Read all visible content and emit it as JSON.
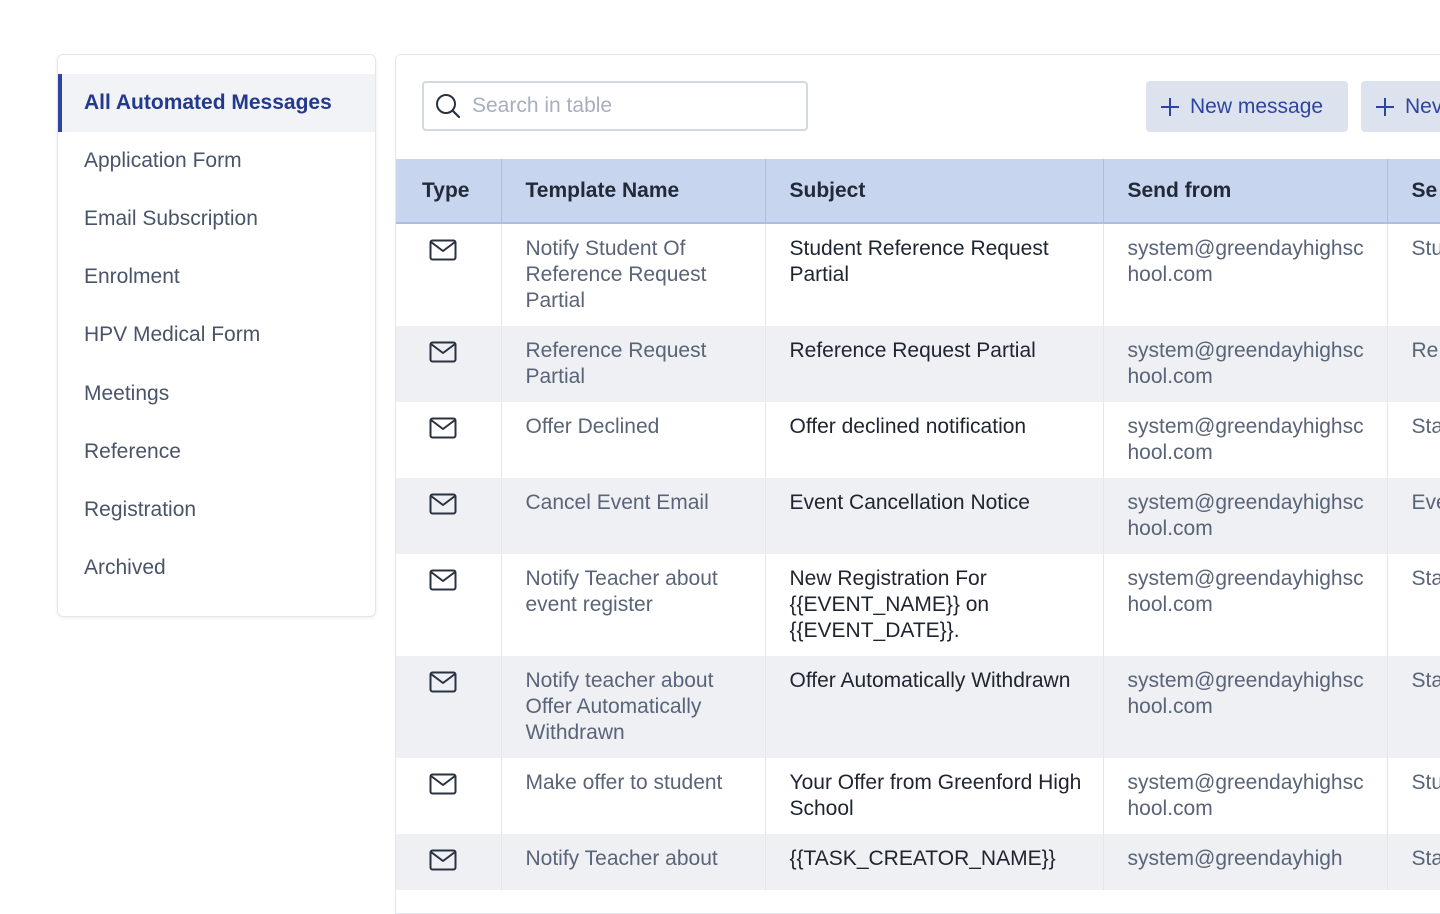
{
  "sidebar": {
    "items": [
      {
        "label": "All Automated Messages",
        "active": true
      },
      {
        "label": "Application Form"
      },
      {
        "label": "Email Subscription"
      },
      {
        "label": "Enrolment"
      },
      {
        "label": "HPV Medical Form"
      },
      {
        "label": "Meetings"
      },
      {
        "label": "Reference"
      },
      {
        "label": "Registration"
      },
      {
        "label": "Archived"
      }
    ]
  },
  "toolbar": {
    "search_placeholder": "Search in table",
    "search_icon": "search-icon",
    "new_message_label": "New message",
    "second_button_label": "Nev"
  },
  "table": {
    "columns": [
      "Type",
      "Template Name",
      "Subject",
      "Send from",
      "Se"
    ],
    "rows": [
      {
        "type_icon": "envelope-icon",
        "name": "Notify Student Of Reference Request Partial",
        "subject": "Student Reference Request Partial",
        "from": "system@greendayhighschool.com",
        "last": "Stu"
      },
      {
        "type_icon": "envelope-icon",
        "name": "Reference Request Partial",
        "subject": "Reference Request Partial",
        "from": "system@greendayhighschool.com",
        "last": "Re"
      },
      {
        "type_icon": "envelope-icon",
        "name": "Offer Declined",
        "subject": "Offer declined notification",
        "from": "system@greendayhighschool.com",
        "last": "Sta"
      },
      {
        "type_icon": "envelope-icon",
        "name": "Cancel Event Email",
        "subject": "Event Cancellation Notice",
        "from": "system@greendayhighschool.com",
        "last": "Eve"
      },
      {
        "type_icon": "envelope-icon",
        "name": "Notify Teacher about event register",
        "subject": "New Registration For {{EVENT_NAME}} on {{EVENT_DATE}}.",
        "from": "system@greendayhighschool.com",
        "last": "Sta"
      },
      {
        "type_icon": "envelope-icon",
        "name": "Notify teacher about Offer Automatically Withdrawn",
        "subject": "Offer Automatically Withdrawn",
        "from": "system@greendayhighschool.com",
        "last": "Sta"
      },
      {
        "type_icon": "envelope-icon",
        "name": "Make offer to student",
        "subject": "Your Offer from Greenford High School",
        "from": "system@greendayhighschool.com",
        "last": "Stu"
      },
      {
        "type_icon": "envelope-icon",
        "name": "Notify Teacher about",
        "subject": "{{TASK_CREATOR_NAME}}",
        "from": "system@greendayhigh",
        "last": "Sta"
      }
    ]
  },
  "colors": {
    "accent": "#2d44a0",
    "header_bg": "#c8d5ee",
    "button_bg": "#dde3ee",
    "zebra": "#eef0f4"
  }
}
